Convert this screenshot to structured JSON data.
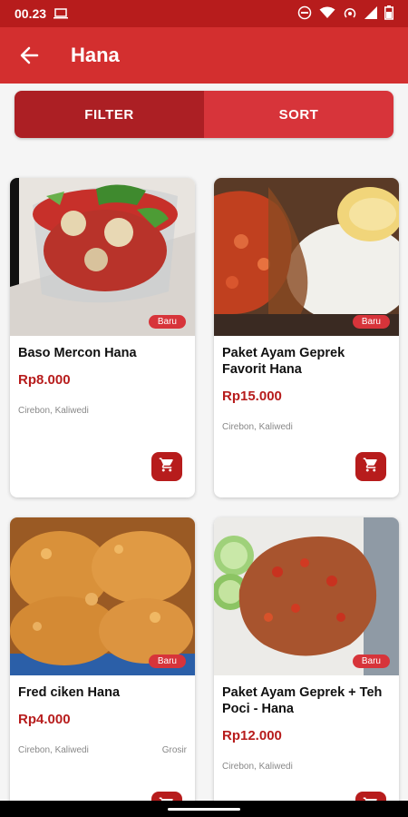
{
  "status_bar": {
    "time": "00.23"
  },
  "app_bar": {
    "title": "Hana",
    "back_icon": "arrow-left-icon"
  },
  "segments": {
    "filter": "FILTER",
    "sort": "SORT"
  },
  "products": [
    {
      "name": "Baso Mercon Hana",
      "price": "Rp8.000",
      "location": "Cirebon, Kaliwedi",
      "tag": "",
      "badge": "Baru"
    },
    {
      "name": "Paket Ayam Geprek Favorit Hana",
      "price": "Rp15.000",
      "location": "Cirebon, Kaliwedi",
      "tag": "",
      "badge": "Baru"
    },
    {
      "name": "Fred ciken Hana",
      "price": "Rp4.000",
      "location": "Cirebon, Kaliwedi",
      "tag": "Grosir",
      "badge": "Baru"
    },
    {
      "name": "Paket Ayam Geprek + Teh Poci - Hana",
      "price": "Rp12.000",
      "location": "Cirebon, Kaliwedi",
      "tag": "",
      "badge": "Baru"
    }
  ],
  "colors": {
    "primary": "#d32f2f",
    "status": "#b71c1c",
    "filter": "#ac1f24",
    "sort": "#d7343a",
    "price": "#b71c1c"
  }
}
